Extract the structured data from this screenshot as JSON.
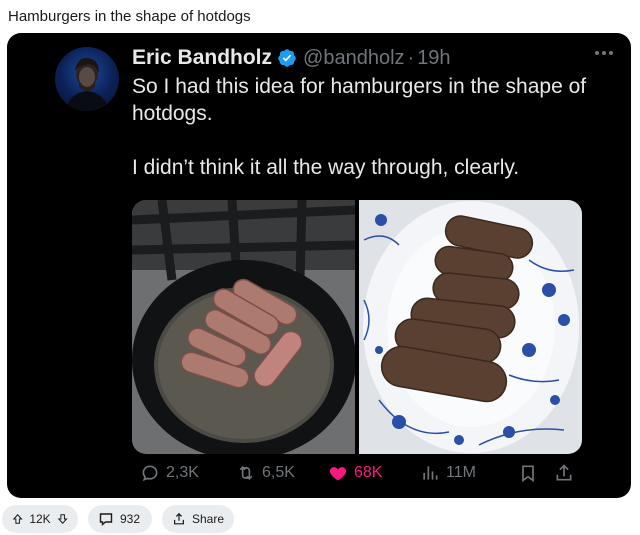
{
  "post": {
    "title": "Hamburgers in the shape of hotdogs"
  },
  "tweet": {
    "author_name": "Eric Bandholz",
    "handle": "@bandholz",
    "separator": "·",
    "time": "19h",
    "verified_icon": "verified-badge-icon",
    "text_line1": "So I had this idea for hamburgers in the shape of hotdogs.",
    "text_line2": "I didn’t think it all the way through, clearly.",
    "metrics": {
      "replies": "2,3K",
      "reposts": "6,5K",
      "likes": "68K",
      "views": "11M"
    },
    "like_color": "#f91880"
  },
  "reddit": {
    "votes": "12K",
    "comments": "932",
    "share_label": "Share"
  }
}
